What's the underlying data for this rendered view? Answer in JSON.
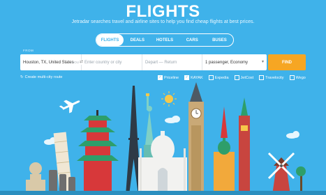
{
  "header": {
    "title": "FLIGHTS",
    "subtitle": "Jetradar searches travel and airline sites to help you find cheap flights at best prices."
  },
  "tabs": [
    {
      "label": "FLIGHTS",
      "active": true
    },
    {
      "label": "DEALS",
      "active": false
    },
    {
      "label": "HOTELS",
      "active": false
    },
    {
      "label": "CARS",
      "active": false
    },
    {
      "label": "BUSES",
      "active": false
    }
  ],
  "search": {
    "from_label": "FROM",
    "from_value": "Houston, TX, United States",
    "from_code": "HOU",
    "to_placeholder": "Enter country or city",
    "dates_placeholder": "Depart — Return",
    "passengers": "1 passenger, Economy",
    "find_label": "FIND"
  },
  "options": {
    "multi_city": "Create multi-city route",
    "providers": [
      {
        "label": "Priceline",
        "checked": true
      },
      {
        "label": "KAYAK",
        "checked": true
      },
      {
        "label": "Expedia",
        "checked": false
      },
      {
        "label": "JetCost",
        "checked": false
      },
      {
        "label": "Travelocity",
        "checked": false
      },
      {
        "label": "Wego",
        "checked": false
      }
    ]
  },
  "colors": {
    "background": "#3fb2ea",
    "accent": "#f6a623"
  }
}
